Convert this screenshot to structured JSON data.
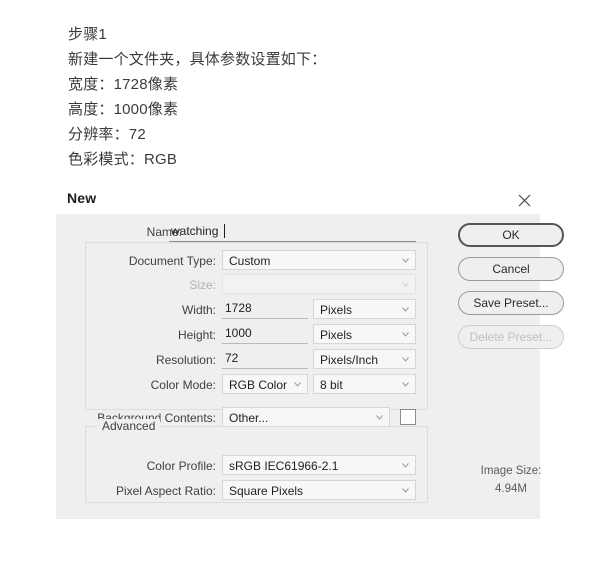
{
  "instructions": {
    "lines": [
      "步骤1",
      "新建一个文件夹，具体参数设置如下：",
      "宽度：1728像素",
      "高度：1000像素",
      "分辨率：72",
      "色彩模式：RGB"
    ]
  },
  "dialog": {
    "title": "New",
    "close_icon": "close-icon",
    "name_field": {
      "label": "Name:",
      "value": "watching",
      "underline_color": "#6f98b5"
    },
    "fields": [
      {
        "label": "Document Type:",
        "value": "Custom",
        "type": "combo",
        "disabled": false
      },
      {
        "label": "Size:",
        "value": "",
        "type": "combo",
        "disabled": true
      },
      {
        "label": "Width:",
        "value": "1728",
        "type": "input",
        "unit": "Pixels"
      },
      {
        "label": "Height:",
        "value": "1000",
        "type": "input",
        "unit": "Pixels"
      },
      {
        "label": "Resolution:",
        "value": "72",
        "type": "input",
        "unit": "Pixels/Inch"
      },
      {
        "label": "Color Mode:",
        "value": "RGB Color",
        "type": "combo",
        "unit": "8 bit"
      },
      {
        "label": "Background Contents:",
        "value": "Other...",
        "type": "combo",
        "swatch": "#ffffff"
      }
    ],
    "advanced": {
      "legend": "Advanced",
      "fields": [
        {
          "label": "Color Profile:",
          "value": "sRGB IEC61966-2.1"
        },
        {
          "label": "Pixel Aspect Ratio:",
          "value": "Square Pixels"
        }
      ]
    },
    "buttons": [
      {
        "label": "OK",
        "state": "default"
      },
      {
        "label": "Cancel",
        "state": "normal"
      },
      {
        "label": "Save Preset...",
        "state": "normal"
      },
      {
        "label": "Delete Preset...",
        "state": "disabled"
      }
    ],
    "image_size": {
      "label": "Image Size:",
      "value": "4.94M"
    }
  }
}
